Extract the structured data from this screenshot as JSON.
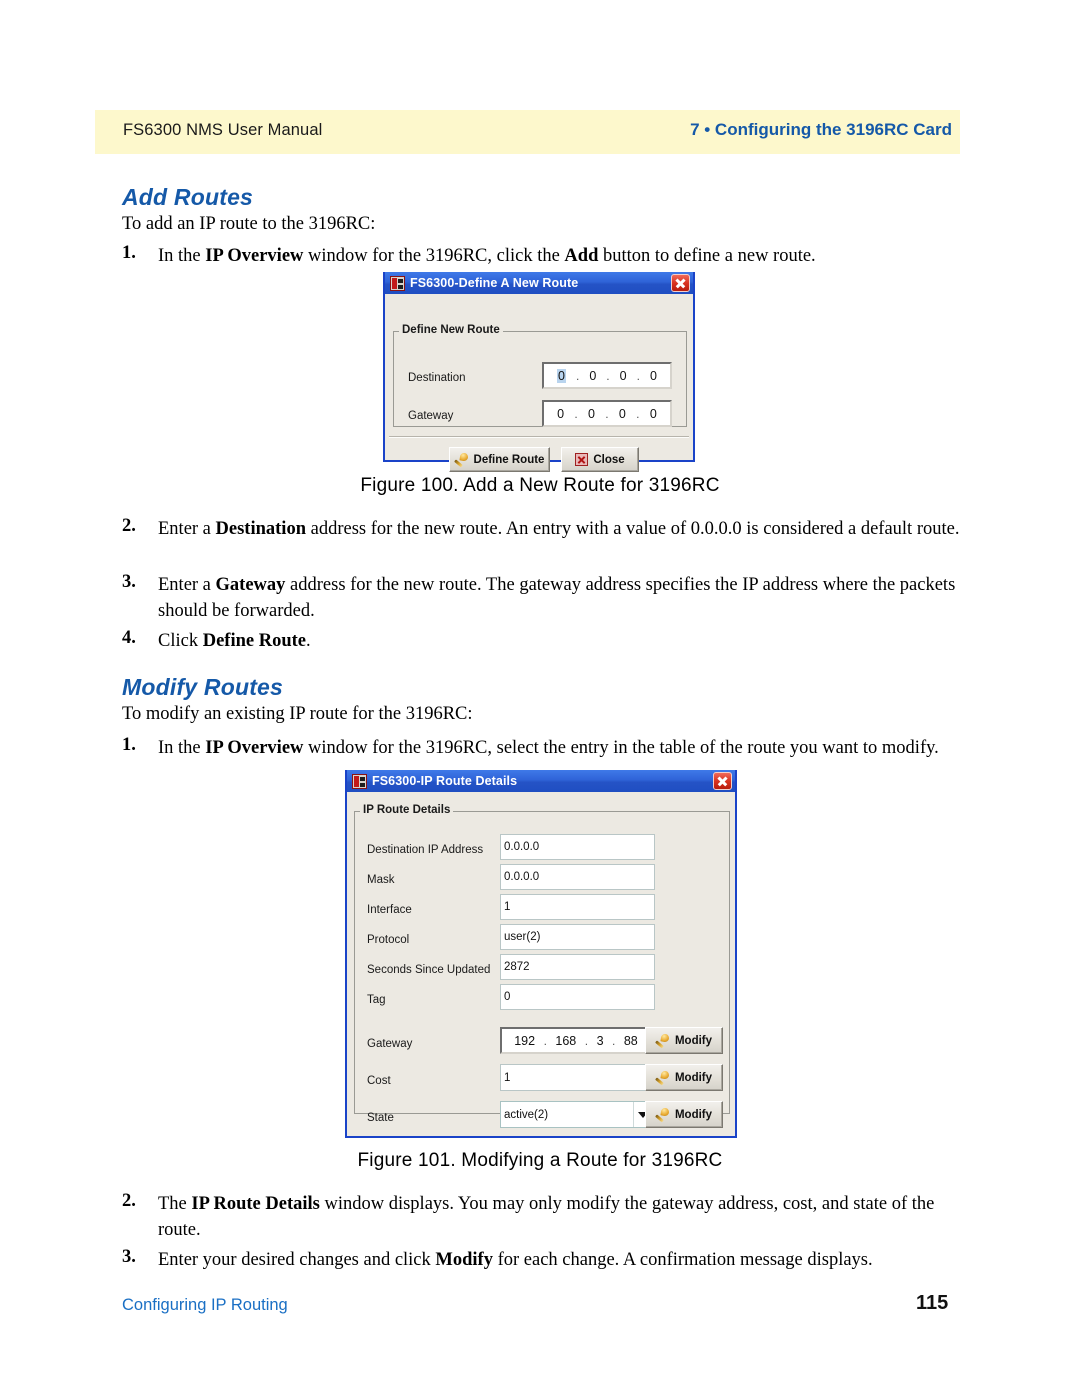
{
  "header": {
    "left": "FS6300 NMS User Manual",
    "right": "7 • Configuring the 3196RC Card"
  },
  "sections": {
    "add_routes": {
      "heading": "Add Routes",
      "intro": "To add an IP route to the 3196RC:",
      "step1_num": "1.",
      "step1_html": "In the <b>IP Overview</b> window for the 3196RC, click the <b>Add</b> button to define a new route.",
      "step2_num": "2.",
      "step2_html": "Enter a <b>Destination</b> address for the new route. An entry with a value of 0.0.0.0 is considered a default route.",
      "step3_num": "3.",
      "step3_html": "Enter a <b>Gateway</b> address for the new route. The gateway address specifies the IP address where the packets should be forwarded.",
      "step4_num": "4.",
      "step4_html": "Click <b>Define Route</b>."
    },
    "modify_routes": {
      "heading": "Modify Routes",
      "intro": "To modify an existing IP route for the 3196RC:",
      "step1_num": "1.",
      "step1_html": "In the <b>IP Overview</b> window for the 3196RC, select the entry in the table of the route you want to modify.",
      "step2_num": "2.",
      "step2_html": "The <b>IP Route Details</b> window displays. You may only modify the gateway address, cost, and state of the route.",
      "step3_num": "3.",
      "step3_html": "Enter your desired changes and click <b>Modify</b> for each change. A confirmation message displays."
    }
  },
  "figures": {
    "fig100_caption": "Figure 100. Add a New Route for 3196RC",
    "fig101_caption": "Figure 101. Modifying a Route for 3196RC"
  },
  "dialog_define_route": {
    "title": "FS6300-Define A New Route",
    "app_icon": "fs6300-app-icon",
    "close_icon": "close-icon",
    "group_legend": "Define New Route",
    "fields": [
      {
        "label": "Destination",
        "octets": [
          "0",
          "0",
          "0",
          "0"
        ],
        "selected_octet": 0
      },
      {
        "label": "Gateway",
        "octets": [
          "0",
          "0",
          "0",
          "0"
        ],
        "selected_octet": -1
      }
    ],
    "buttons": [
      {
        "label": "Define Route",
        "icon": "key-icon"
      },
      {
        "label": "Close",
        "icon": "red-x-icon"
      }
    ]
  },
  "dialog_route_details": {
    "title": "FS6300-IP Route Details",
    "app_icon": "fs6300-app-icon",
    "close_icon": "close-icon",
    "group_legend": "IP Route Details",
    "rows": [
      {
        "label": "Destination IP Address",
        "value": "0.0.0.0",
        "type": "text",
        "modify": false
      },
      {
        "label": "Mask",
        "value": "0.0.0.0",
        "type": "text",
        "modify": false
      },
      {
        "label": "Interface",
        "value": "1",
        "type": "text",
        "modify": false
      },
      {
        "label": "Protocol",
        "value": "user(2)",
        "type": "text",
        "modify": false
      },
      {
        "label": "Seconds Since Updated",
        "value": "2872",
        "type": "text",
        "modify": false
      },
      {
        "label": "Tag",
        "value": "0",
        "type": "text",
        "modify": false
      }
    ],
    "editable_rows": [
      {
        "label": "Gateway",
        "type": "ip",
        "octets": [
          "192",
          "168",
          "3",
          "88"
        ],
        "modify_label": "Modify"
      },
      {
        "label": "Cost",
        "type": "text",
        "value": "1",
        "modify_label": "Modify"
      },
      {
        "label": "State",
        "type": "combo",
        "value": "active(2)",
        "modify_label": "Modify"
      }
    ]
  },
  "footer": {
    "left": "Configuring IP Routing",
    "page": "115"
  },
  "colors": {
    "header_banner": "#fdf8cc",
    "heading_blue": "#1559a8",
    "footer_link_blue": "#1a6fc4",
    "titlebar_blue": "#2553c6",
    "dialog_face": "#ece9e2"
  }
}
